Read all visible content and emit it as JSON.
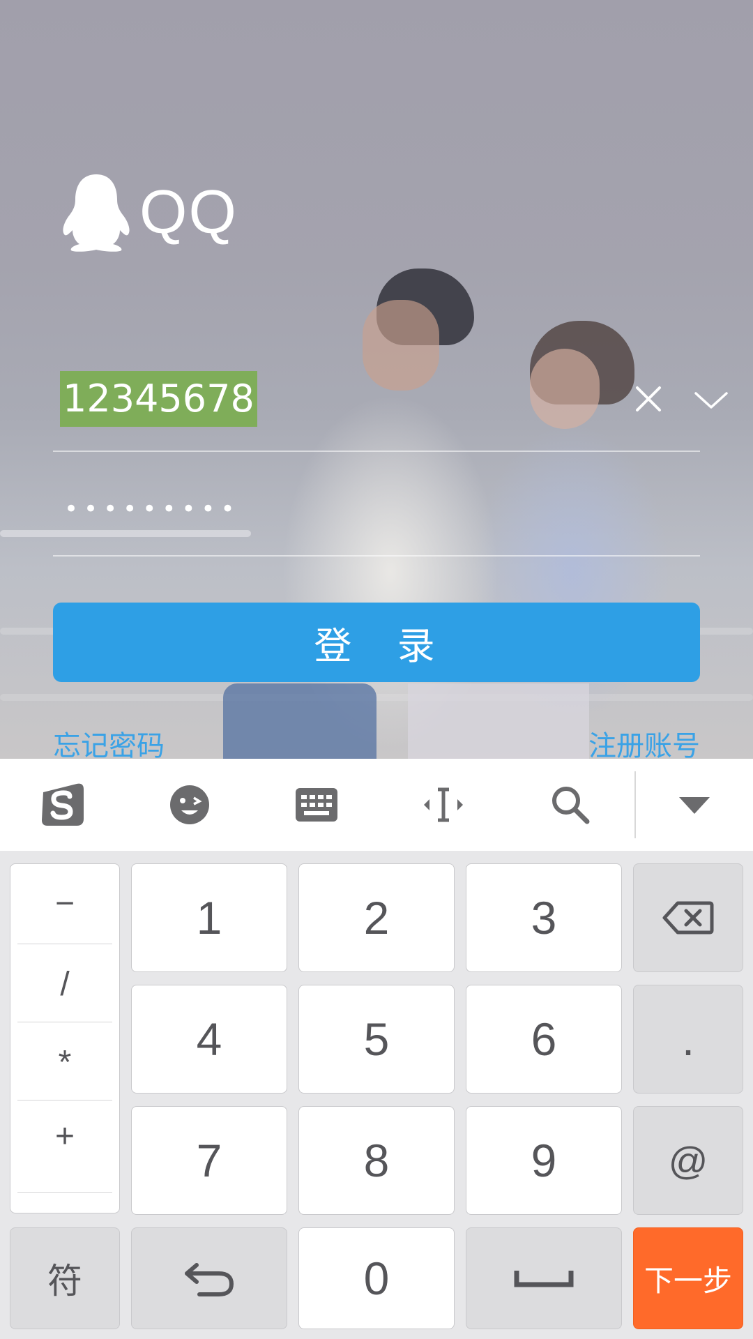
{
  "app": {
    "brand": "QQ"
  },
  "login": {
    "account_value": "12345678",
    "password_masked": "•••••••••",
    "login_button": "登 录",
    "forgot_password": "忘记密码",
    "register_account": "注册账号"
  },
  "keyboard_toolbar": {
    "icons": [
      "sogou-logo-icon",
      "emoji-icon",
      "keyboard-icon",
      "cursor-move-icon",
      "search-icon",
      "collapse-keyboard-icon"
    ]
  },
  "keyboard": {
    "side_symbols": [
      "−",
      "/",
      "*",
      "+"
    ],
    "keys": {
      "k1": "1",
      "k2": "2",
      "k3": "3",
      "k4": "4",
      "k5": "5",
      "k6": "6",
      "k7": "7",
      "k8": "8",
      "k9": "9",
      "k0": "0",
      "dot": ".",
      "at": "@",
      "symbols": "符",
      "next": "下一步"
    }
  },
  "colors": {
    "login_button": "#2e9fe5",
    "link": "#3aa2e6",
    "selection_highlight": "#7fad59",
    "next_key": "#ff6a2a"
  }
}
